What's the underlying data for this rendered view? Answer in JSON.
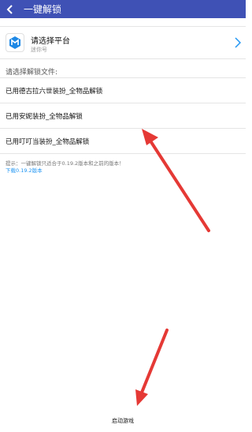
{
  "header": {
    "back_icon": "back-arrow-icon",
    "title": "一键解锁",
    "bg": "#3f51b5"
  },
  "platform": {
    "title": "请选择平台",
    "subtitle": "迷你号",
    "icon": "mini-world-logo-icon"
  },
  "files_label": "请选择解锁文件:",
  "files": [
    {
      "label": "已用德古拉六世装扮_全物品解锁"
    },
    {
      "label": "已用安妮装扮_全物品解锁"
    },
    {
      "label": "已用叮叮当装扮_全物品解锁"
    }
  ],
  "hint": "提示：一键解锁只适合于0.19.2版本和之前的版本！",
  "download_link": "下载0.19.2版本",
  "start_button": "启动游戏",
  "colors": {
    "accent": "#3f51b5",
    "link": "#2196f3",
    "annotation": "#e53935"
  }
}
